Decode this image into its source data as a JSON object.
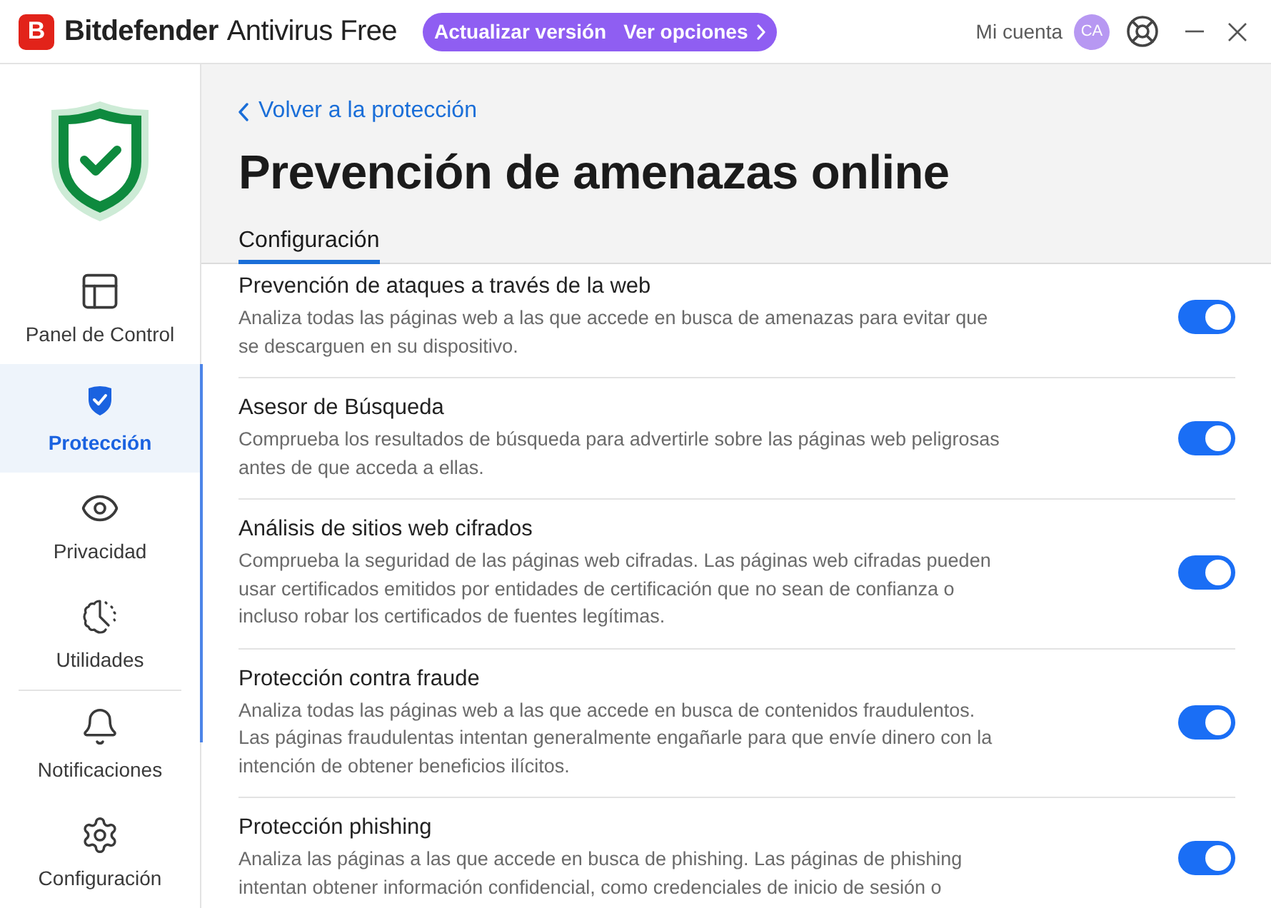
{
  "window": {
    "logo_letter": "B",
    "brand": "Bitdefender",
    "product": "Antivirus Free"
  },
  "upgrade": {
    "label": "Actualizar versión",
    "options": "Ver opciones"
  },
  "account": {
    "label": "Mi cuenta",
    "initials": "CA"
  },
  "sidebar": {
    "sections": [
      {
        "items": [
          {
            "label": "Panel de Control",
            "selected": false
          },
          {
            "label": "Protección",
            "selected": true
          },
          {
            "label": "Privacidad",
            "selected": false
          },
          {
            "label": "Utilidades",
            "selected": false
          }
        ]
      },
      {
        "items": [
          {
            "label": "Notificaciones",
            "selected": false
          },
          {
            "label": "Configuración",
            "selected": false
          }
        ]
      }
    ]
  },
  "back_link": "Volver a la protección",
  "title": "Prevención de amenazas online",
  "tabs": [
    {
      "label": "Configuración",
      "selected": true
    }
  ],
  "settings": [
    {
      "title": "Prevención de ataques a través de la web",
      "description": "Analiza todas las páginas web a las que accede en busca de amenazas para evitar que se descarguen en su dispositivo.",
      "on": true
    },
    {
      "title": "Asesor de Búsqueda",
      "description": "Comprueba los resultados de búsqueda para advertirle sobre las páginas web peligrosas antes de que acceda a ellas.",
      "on": true
    },
    {
      "title": "Análisis de sitios web cifrados",
      "description": "Comprueba la seguridad de las páginas web cifradas. Las páginas web cifradas pueden usar certificados emitidos por entidades de certificación que no sean de confianza o incluso robar los certificados de fuentes legítimas.",
      "on": true
    },
    {
      "title": "Protección contra fraude",
      "description": "Analiza todas las páginas web a las que accede en busca de contenidos fraudulentos. Las páginas fraudulentas intentan generalmente engañarle para que envíe dinero con la intención de obtener beneficios ilícitos.",
      "on": true
    },
    {
      "title": "Protección phishing",
      "description": "Analiza las páginas a las que accede en busca de phishing. Las páginas de phishing intentan obtener información confidencial, como credenciales de inicio de sesión o",
      "on": true
    }
  ]
}
